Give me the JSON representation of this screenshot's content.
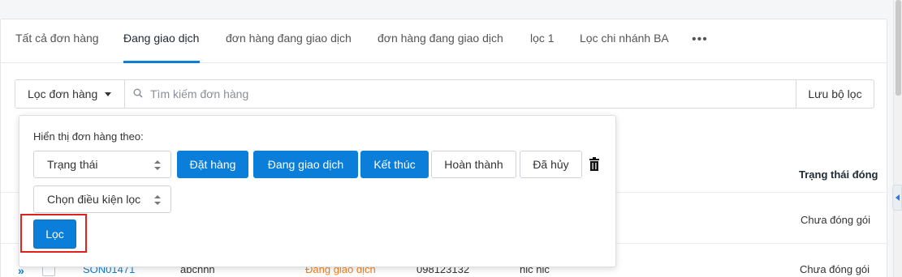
{
  "tabs": [
    {
      "label": "Tất cả đơn hàng"
    },
    {
      "label": "Đang giao dịch"
    },
    {
      "label": "đơn hàng đang giao dịch"
    },
    {
      "label": "đơn hàng đang giao dịch"
    },
    {
      "label": "lọc 1"
    },
    {
      "label": "Lọc chi nhánh BA"
    }
  ],
  "active_tab_index": 1,
  "more_label": "•••",
  "filter_bar": {
    "dropdown_label": "Lọc đơn hàng",
    "search_placeholder": "Tìm kiếm đơn hàng",
    "save_label": "Lưu bộ lọc"
  },
  "popup": {
    "title": "Hiển thị đơn hàng theo:",
    "field_select": "Trạng thái",
    "condition_select": "Chọn điều kiện lọc",
    "status_options": [
      {
        "label": "Đặt hàng",
        "selected": true
      },
      {
        "label": "Đang giao dịch",
        "selected": true
      },
      {
        "label": "Kết thúc",
        "selected": true
      },
      {
        "label": "Hoàn thành",
        "selected": false
      },
      {
        "label": "Đã hủy",
        "selected": false
      }
    ],
    "apply_label": "Lọc"
  },
  "table": {
    "column_header": "Trạng thái đóng",
    "rows": [
      {
        "code": "",
        "customer": "",
        "status": "",
        "phone": "",
        "note": "",
        "pack_status": "Chưa đóng gói"
      },
      {
        "code": "SON01471",
        "customer": "abchhh",
        "status": "Đang giao dịch",
        "phone": "098123132",
        "note": "hic hic",
        "pack_status": "Chưa đóng gói"
      }
    ]
  },
  "colors": {
    "accent": "#0b7ed9",
    "highlight": "#e3211c",
    "status_orange": "#f5811f"
  }
}
